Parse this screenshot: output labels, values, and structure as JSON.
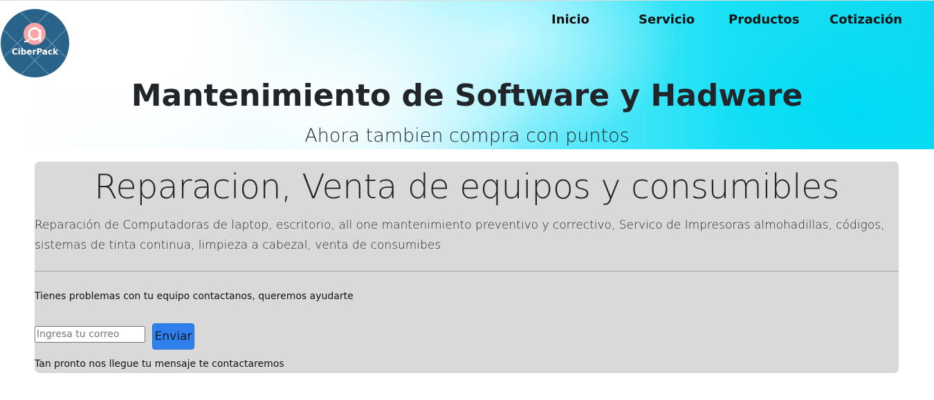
{
  "header": {
    "logo_text": "CiberPack",
    "nav": [
      "Inicio",
      "Servicio",
      "Productos",
      "Cotización"
    ]
  },
  "hero": {
    "title": "Mantenimiento de Software y Hadware",
    "subtitle": "Ahora tambien compra con puntos"
  },
  "jumbotron": {
    "title": "Reparacion, Venta de equipos y consumibles",
    "lead": "Reparación de Computadoras de laptop, escritorio, all one mantenimiento preventivo y correctivo, Servico de Impresoras almohadillas, códigos, sistemas de tinta continua, limpieza a cabezal, venta de consumibes",
    "message": "Tienes problemas con tu equipo contactanos, queremos ayudarte",
    "email_placeholder": "Ingresa tu correo",
    "email_value": "",
    "submit_label": "Enviar",
    "note": "Tan pronto nos llegue tu mensaje te contactaremos"
  },
  "colors": {
    "logo_bg": "#2a6389",
    "hero_accent": "#18e0f5",
    "panel_bg": "#d9d9d9",
    "button_bg": "#2f80ed"
  }
}
